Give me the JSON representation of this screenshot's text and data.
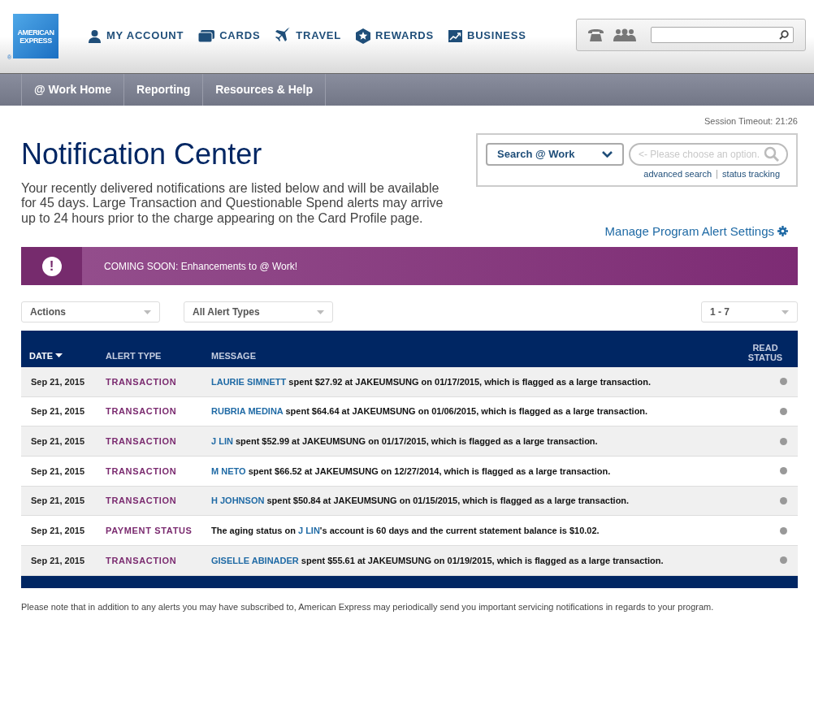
{
  "logo": {
    "lines": [
      "AMERICAN",
      "EXPRESS"
    ],
    "mark": "®"
  },
  "top_nav": [
    {
      "label": "MY ACCOUNT",
      "kind": "person"
    },
    {
      "label": "CARDS",
      "kind": "card"
    },
    {
      "label": "TRAVEL",
      "kind": "plane"
    },
    {
      "label": "REWARDS",
      "kind": "star"
    },
    {
      "label": "BUSINESS",
      "kind": "chart"
    }
  ],
  "sub_nav": [
    "@ Work Home",
    "Reporting",
    "Resources & Help"
  ],
  "session_timeout": "Session Timeout: 21:26",
  "title": "Notification Center",
  "intro": "Your recently delivered notifications are listed below and will be available for 45 days. Large Transaction and Questionable Spend alerts may arrive up to 24 hours prior to the charge appearing on the Card Profile page.",
  "search_box": {
    "dropdown": "Search @ Work",
    "placeholder": "<- Please choose an option.",
    "links": [
      "advanced search",
      "status tracking"
    ]
  },
  "manage_link": "Manage Program Alert Settings",
  "banner": {
    "icon": "!",
    "text": "COMING SOON: Enhancements to @ Work!"
  },
  "filters": {
    "actions": "Actions",
    "alert_types": "All Alert Types",
    "range": "1 - 7"
  },
  "table": {
    "columns": [
      {
        "label": "DATE",
        "sorted": true
      },
      {
        "label": "ALERT TYPE",
        "sorted": false
      },
      {
        "label": "MESSAGE",
        "sorted": false
      },
      {
        "label": "READ STATUS",
        "sorted": false
      }
    ],
    "rows": [
      {
        "date": "Sep 21, 2015",
        "type": "TRANSACTION",
        "read": false,
        "message": [
          {
            "kind": "link",
            "text": "LAURIE SIMNETT"
          },
          {
            "kind": "text",
            "text": " spent $27.92 at JAKEUMSUNG on 01/17/2015, which is flagged as a large transaction."
          }
        ]
      },
      {
        "date": "Sep 21, 2015",
        "type": "TRANSACTION",
        "read": false,
        "message": [
          {
            "kind": "link",
            "text": "RUBRIA MEDINA"
          },
          {
            "kind": "text",
            "text": " spent $64.64 at JAKEUMSUNG on 01/06/2015, which is flagged as a large transaction."
          }
        ]
      },
      {
        "date": "Sep 21, 2015",
        "type": "TRANSACTION",
        "read": false,
        "message": [
          {
            "kind": "link",
            "text": "J LIN"
          },
          {
            "kind": "text",
            "text": " spent $52.99 at JAKEUMSUNG on 01/17/2015, which is flagged as a large transaction."
          }
        ]
      },
      {
        "date": "Sep 21, 2015",
        "type": "TRANSACTION",
        "read": false,
        "message": [
          {
            "kind": "link",
            "text": "M NETO"
          },
          {
            "kind": "text",
            "text": " spent $66.52 at JAKEUMSUNG on 12/27/2014, which is flagged as a large transaction."
          }
        ]
      },
      {
        "date": "Sep 21, 2015",
        "type": "TRANSACTION",
        "read": false,
        "message": [
          {
            "kind": "link",
            "text": "H JOHNSON"
          },
          {
            "kind": "text",
            "text": " spent $50.84 at JAKEUMSUNG on 01/15/2015, which is flagged as a large transaction."
          }
        ]
      },
      {
        "date": "Sep 21, 2015",
        "type": "PAYMENT STATUS",
        "read": false,
        "message": [
          {
            "kind": "text",
            "text": "The aging status on "
          },
          {
            "kind": "link",
            "text": "J LIN"
          },
          {
            "kind": "text",
            "text": "'s account is 60 days and the current statement balance is $10.02."
          }
        ]
      },
      {
        "date": "Sep 21, 2015",
        "type": "TRANSACTION",
        "read": false,
        "message": [
          {
            "kind": "link",
            "text": "GISELLE ABINADER"
          },
          {
            "kind": "text",
            "text": " spent $55.61 at JAKEUMSUNG on 01/19/2015, which is flagged as a large transaction."
          }
        ]
      }
    ]
  },
  "footnote": "Please note that in addition to any alerts you may have subscribed to, American Express may periodically send you important servicing notifications in regards to your program."
}
